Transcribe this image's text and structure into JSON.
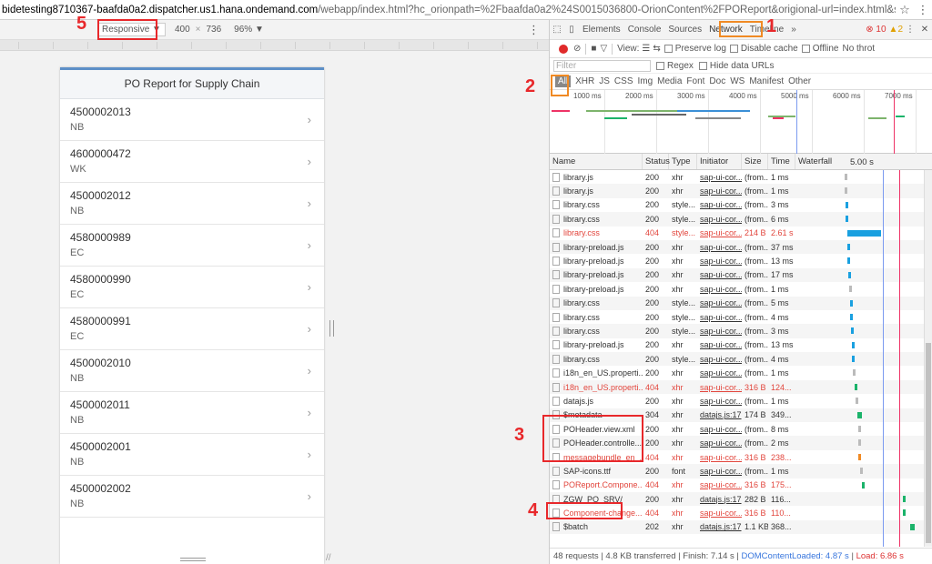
{
  "address": {
    "host": "bidetesting8710367-baafda0a2.dispatcher.us1.hana.ondemand.com",
    "path": "/webapp/index.html?hc_orionpath=%2Fbaafda0a2%24S0015036800-OrionContent%2FPOReport&origional-url=index.html&sap-ui-appCache"
  },
  "emulation": {
    "device": "Responsive",
    "width": "400",
    "height": "736",
    "zoom": "96%"
  },
  "app": {
    "title": "PO Report for Supply Chain",
    "items": [
      {
        "number": "4500002013",
        "type": "NB"
      },
      {
        "number": "4600000472",
        "type": "WK"
      },
      {
        "number": "4500002012",
        "type": "NB"
      },
      {
        "number": "4580000989",
        "type": "EC"
      },
      {
        "number": "4580000990",
        "type": "EC"
      },
      {
        "number": "4580000991",
        "type": "EC"
      },
      {
        "number": "4500002010",
        "type": "NB"
      },
      {
        "number": "4500002011",
        "type": "NB"
      },
      {
        "number": "4500002001",
        "type": "NB"
      },
      {
        "number": "4500002002",
        "type": "NB"
      }
    ]
  },
  "devtools": {
    "tabs": [
      "Elements",
      "Console",
      "Sources",
      "Network",
      "Timeline",
      "»"
    ],
    "errors": "10",
    "warnings": "2",
    "toolbar": {
      "view": "View:",
      "preserve": "Preserve log",
      "disable_cache": "Disable cache",
      "offline": "Offline",
      "throttle": "No throt"
    },
    "filter_placeholder": "Filter",
    "regex": "Regex",
    "hide_data": "Hide data URLs",
    "types": [
      "All",
      "XHR",
      "JS",
      "CSS",
      "Img",
      "Media",
      "Font",
      "Doc",
      "WS",
      "Manifest",
      "Other"
    ],
    "overview_labels": [
      "1000 ms",
      "2000 ms",
      "3000 ms",
      "4000 ms",
      "5000 ms",
      "6000 ms",
      "7000 ms"
    ],
    "columns": [
      "Name",
      "Status",
      "Type",
      "Initiator",
      "Size",
      "Time",
      "Waterfall",
      "5.00 s"
    ],
    "requests": [
      {
        "name": "library.js",
        "status": "200",
        "type": "xhr",
        "initiator": "sap-ui-cor...",
        "size": "(from...",
        "time": "1 ms",
        "err": false,
        "wf": [
          0.37,
          0.005,
          "#bbb"
        ]
      },
      {
        "name": "library.js",
        "status": "200",
        "type": "xhr",
        "initiator": "sap-ui-cor...",
        "size": "(from...",
        "time": "1 ms",
        "err": false,
        "wf": [
          0.37,
          0.005,
          "#bbb"
        ]
      },
      {
        "name": "library.css",
        "status": "200",
        "type": "style...",
        "initiator": "sap-ui-cor...",
        "size": "(from...",
        "time": "3 ms",
        "err": false,
        "wf": [
          0.375,
          0.01,
          "#19a0e0"
        ]
      },
      {
        "name": "library.css",
        "status": "200",
        "type": "style...",
        "initiator": "sap-ui-cor...",
        "size": "(from...",
        "time": "6 ms",
        "err": false,
        "wf": [
          0.375,
          0.01,
          "#19a0e0"
        ]
      },
      {
        "name": "library.css",
        "status": "404",
        "type": "style...",
        "initiator": "sap-ui-cor...",
        "size": "214 B",
        "time": "2.61 s",
        "err": true,
        "wf": [
          0.39,
          0.25,
          "#19a0e0"
        ]
      },
      {
        "name": "library-preload.js",
        "status": "200",
        "type": "xhr",
        "initiator": "sap-ui-cor...",
        "size": "(from...",
        "time": "37 ms",
        "err": false,
        "wf": [
          0.39,
          0.01,
          "#19a0e0"
        ]
      },
      {
        "name": "library-preload.js",
        "status": "200",
        "type": "xhr",
        "initiator": "sap-ui-cor...",
        "size": "(from...",
        "time": "13 ms",
        "err": false,
        "wf": [
          0.39,
          0.01,
          "#19a0e0"
        ]
      },
      {
        "name": "library-preload.js",
        "status": "200",
        "type": "xhr",
        "initiator": "sap-ui-cor...",
        "size": "(from...",
        "time": "17 ms",
        "err": false,
        "wf": [
          0.395,
          0.01,
          "#19a0e0"
        ]
      },
      {
        "name": "library-preload.js",
        "status": "200",
        "type": "xhr",
        "initiator": "sap-ui-cor...",
        "size": "(from...",
        "time": "1 ms",
        "err": false,
        "wf": [
          0.4,
          0.005,
          "#bbb"
        ]
      },
      {
        "name": "library.css",
        "status": "200",
        "type": "style...",
        "initiator": "sap-ui-cor...",
        "size": "(from...",
        "time": "5 ms",
        "err": false,
        "wf": [
          0.405,
          0.01,
          "#19a0e0"
        ]
      },
      {
        "name": "library.css",
        "status": "200",
        "type": "style...",
        "initiator": "sap-ui-cor...",
        "size": "(from...",
        "time": "4 ms",
        "err": false,
        "wf": [
          0.41,
          0.01,
          "#19a0e0"
        ]
      },
      {
        "name": "library.css",
        "status": "200",
        "type": "style...",
        "initiator": "sap-ui-cor...",
        "size": "(from...",
        "time": "3 ms",
        "err": false,
        "wf": [
          0.415,
          0.01,
          "#19a0e0"
        ]
      },
      {
        "name": "library-preload.js",
        "status": "200",
        "type": "xhr",
        "initiator": "sap-ui-cor...",
        "size": "(from...",
        "time": "13 ms",
        "err": false,
        "wf": [
          0.42,
          0.01,
          "#19a0e0"
        ]
      },
      {
        "name": "library.css",
        "status": "200",
        "type": "style...",
        "initiator": "sap-ui-cor...",
        "size": "(from...",
        "time": "4 ms",
        "err": false,
        "wf": [
          0.425,
          0.01,
          "#19a0e0"
        ]
      },
      {
        "name": "i18n_en_US.properti...",
        "status": "200",
        "type": "xhr",
        "initiator": "sap-ui-cor...",
        "size": "(from...",
        "time": "1 ms",
        "err": false,
        "wf": [
          0.43,
          0.005,
          "#bbb"
        ]
      },
      {
        "name": "i18n_en_US.properti...",
        "status": "404",
        "type": "xhr",
        "initiator": "sap-ui-cor...",
        "size": "316 B",
        "time": "124...",
        "err": true,
        "wf": [
          0.44,
          0.015,
          "#1bb36a"
        ]
      },
      {
        "name": "datajs.js",
        "status": "200",
        "type": "xhr",
        "initiator": "sap-ui-cor...",
        "size": "(from...",
        "time": "1 ms",
        "err": false,
        "wf": [
          0.45,
          0.005,
          "#bbb"
        ]
      },
      {
        "name": "$metadata",
        "status": "304",
        "type": "xhr",
        "initiator": "datajs.js:17",
        "size": "174 B",
        "time": "349...",
        "err": false,
        "wf": [
          0.46,
          0.035,
          "#1bb36a"
        ]
      },
      {
        "name": "POHeader.view.xml",
        "status": "200",
        "type": "xhr",
        "initiator": "sap-ui-cor...",
        "size": "(from...",
        "time": "8 ms",
        "err": false,
        "wf": [
          0.47,
          0.005,
          "#bbb"
        ]
      },
      {
        "name": "POHeader.controlle...",
        "status": "200",
        "type": "xhr",
        "initiator": "sap-ui-cor...",
        "size": "(from...",
        "time": "2 ms",
        "err": false,
        "wf": [
          0.47,
          0.005,
          "#bbb"
        ]
      },
      {
        "name": "messagebundle_en_...",
        "status": "404",
        "type": "xhr",
        "initiator": "sap-ui-cor...",
        "size": "316 B",
        "time": "238...",
        "err": true,
        "wf": [
          0.47,
          0.02,
          "#f08a24"
        ]
      },
      {
        "name": "SAP-icons.ttf",
        "status": "200",
        "type": "font",
        "initiator": "sap-ui-cor...",
        "size": "(from...",
        "time": "1 ms",
        "err": false,
        "wf": [
          0.48,
          0.005,
          "#bbb"
        ]
      },
      {
        "name": "POReport.Compone...",
        "status": "404",
        "type": "xhr",
        "initiator": "sap-ui-cor...",
        "size": "316 B",
        "time": "175...",
        "err": true,
        "wf": [
          0.495,
          0.02,
          "#1bb36a"
        ]
      },
      {
        "name": "ZGW_PO_SRV/",
        "status": "200",
        "type": "xhr",
        "initiator": "datajs.js:17",
        "size": "282 B",
        "time": "116...",
        "err": false,
        "wf": [
          0.8,
          0.015,
          "#1bb36a"
        ]
      },
      {
        "name": "Component-change...",
        "status": "404",
        "type": "xhr",
        "initiator": "sap-ui-cor...",
        "size": "316 B",
        "time": "110...",
        "err": true,
        "wf": [
          0.8,
          0.015,
          "#1bb36a"
        ]
      },
      {
        "name": "$batch",
        "status": "202",
        "type": "xhr",
        "initiator": "datajs.js:17",
        "size": "1.1 KB",
        "time": "368...",
        "err": false,
        "wf": [
          0.86,
          0.035,
          "#1bb36a"
        ]
      }
    ],
    "status_bar": {
      "requests": "48 requests",
      "transferred": "4.8 KB transferred",
      "finish": "Finish: 7.14 s",
      "dcl": "DOMContentLoaded: 4.87 s",
      "load": "Load: 6.86 s"
    }
  },
  "annotations": [
    "1",
    "2",
    "3",
    "4",
    "5"
  ],
  "colors": {
    "red": "#e8282b",
    "orange": "#f08a24",
    "accent": "#5d8fc7"
  }
}
